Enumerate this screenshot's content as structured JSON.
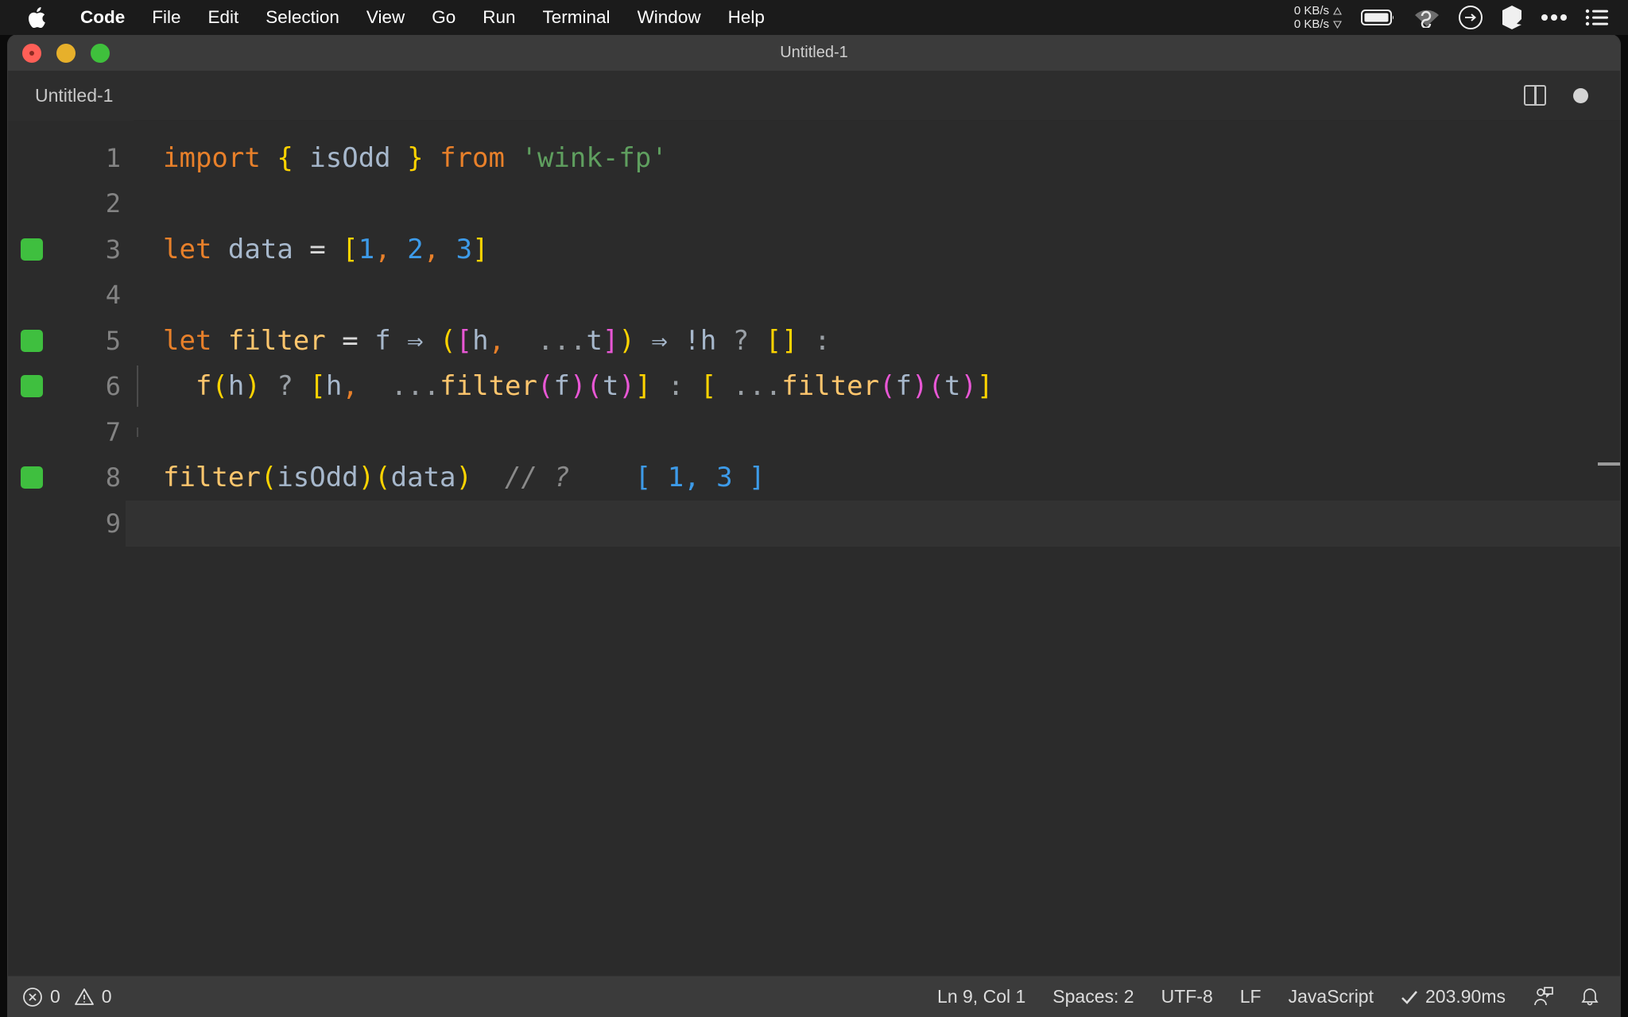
{
  "menubar": {
    "apple_icon": "apple-logo",
    "items": [
      {
        "label": "Code",
        "bold": true
      },
      {
        "label": "File",
        "bold": false
      },
      {
        "label": "Edit",
        "bold": false
      },
      {
        "label": "Selection",
        "bold": false
      },
      {
        "label": "View",
        "bold": false
      },
      {
        "label": "Go",
        "bold": false
      },
      {
        "label": "Run",
        "bold": false
      },
      {
        "label": "Terminal",
        "bold": false
      },
      {
        "label": "Window",
        "bold": false
      },
      {
        "label": "Help",
        "bold": false
      }
    ],
    "tray": {
      "upload_speed": "0 KB/s",
      "download_speed": "0 KB/s",
      "upload_icon": "triangle-up-icon",
      "download_icon": "triangle-down-icon",
      "battery_icon": "battery-icon",
      "wifi_icon": "wifi-icon",
      "shortcut_icon": "arrow-circle-icon",
      "cube_icon": "cube-icon",
      "overflow_icon": "ellipsis-icon",
      "controlcenter_icon": "control-center-icon"
    }
  },
  "window": {
    "title": "Untitled-1",
    "traffic_lights": [
      "close-button",
      "minimize-button",
      "zoom-button"
    ]
  },
  "tabstrip": {
    "tab_label": "Untitled-1",
    "split_editor_icon": "split-editor-icon",
    "unsaved_indicator": "unsaved-dot-icon"
  },
  "editor": {
    "language": "JavaScript",
    "lines": [
      {
        "num": "1",
        "marked": false
      },
      {
        "num": "2",
        "marked": false
      },
      {
        "num": "3",
        "marked": true
      },
      {
        "num": "4",
        "marked": false
      },
      {
        "num": "5",
        "marked": true
      },
      {
        "num": "6",
        "marked": true
      },
      {
        "num": "7",
        "marked": false
      },
      {
        "num": "8",
        "marked": true
      },
      {
        "num": "9",
        "marked": false
      }
    ],
    "code": {
      "l1": {
        "t1": "import",
        "t2": " ",
        "t3": "{",
        "t4": " ",
        "t5": "isOdd",
        "t6": " ",
        "t7": "}",
        "t8": " ",
        "t9": "from",
        "t10": " ",
        "t11": "'wink-fp'"
      },
      "l3": {
        "t1": "let",
        "t2": " ",
        "t3": "data",
        "t4": " ",
        "t5": "=",
        "t6": " ",
        "t7": "[",
        "t8": "1",
        "t9": ",",
        "t10": " ",
        "t11": "2",
        "t12": ",",
        "t13": " ",
        "t14": "3",
        "t15": "]"
      },
      "l5": {
        "t1": "let",
        "t2": " ",
        "t3": "filter",
        "t4": " ",
        "t5": "=",
        "t6": " ",
        "t7": "f",
        "t8": " ",
        "t9": "⇒",
        "t10": " ",
        "t11": "(",
        "t12": "[",
        "t13": "h",
        "t14": ",",
        "t15": "  ",
        "t16": "...",
        "t17": "t",
        "t18": "]",
        "t19": ")",
        "t20": " ",
        "t21": "⇒",
        "t22": " ",
        "t23": "!h",
        "t24": " ",
        "t25": "?",
        "t26": " ",
        "t27": "[]",
        "t28": " ",
        "t29": ":"
      },
      "l6": {
        "t1": "f",
        "t2": "(",
        "t3": "h",
        "t4": ")",
        "t5": " ",
        "t6": "?",
        "t7": " ",
        "t8": "[",
        "t9": "h",
        "t10": ",",
        "t11": "  ",
        "t12": "...",
        "t13": "filter",
        "t14": "(",
        "t15": "f",
        "t16": ")",
        "t17": "(",
        "t18": "t",
        "t19": ")",
        "t20": "]",
        "t21": " ",
        "t22": ":",
        "t23": " ",
        "t24": "[",
        "t25": " ",
        "t26": "...",
        "t27": "filter",
        "t28": "(",
        "t29": "f",
        "t30": ")",
        "t31": "(",
        "t32": "t",
        "t33": ")",
        "t34": "]"
      },
      "l8": {
        "t1": "filter",
        "t2": "(",
        "t3": "isOdd",
        "t4": ")",
        "t5": "(",
        "t6": "data",
        "t7": ")",
        "t8": "  ",
        "t9": "// ?",
        "t10": "    ",
        "t11": "[ 1, 3 ]"
      }
    }
  },
  "statusbar": {
    "error_icon": "error-circle-icon",
    "error_count": "0",
    "warning_icon": "warning-triangle-icon",
    "warning_count": "0",
    "cursor_position": "Ln 9, Col 1",
    "indentation": "Spaces: 2",
    "encoding": "UTF-8",
    "line_ending": "LF",
    "language_mode": "JavaScript",
    "run_status_icon": "checkmark-icon",
    "run_time": "203.90ms",
    "feedback_icon": "feedback-icon",
    "notifications_icon": "bell-icon"
  },
  "colors": {
    "accent_green": "#3fbf3f",
    "keyword_orange": "#e8802a",
    "function_gold": "#ffc66d",
    "number_blue": "#3d9be9",
    "string_green": "#5f9f5f",
    "bracket_yellow": "#ffd400",
    "bracket_pink": "#e857d5",
    "editor_bg": "#2b2b2b"
  }
}
